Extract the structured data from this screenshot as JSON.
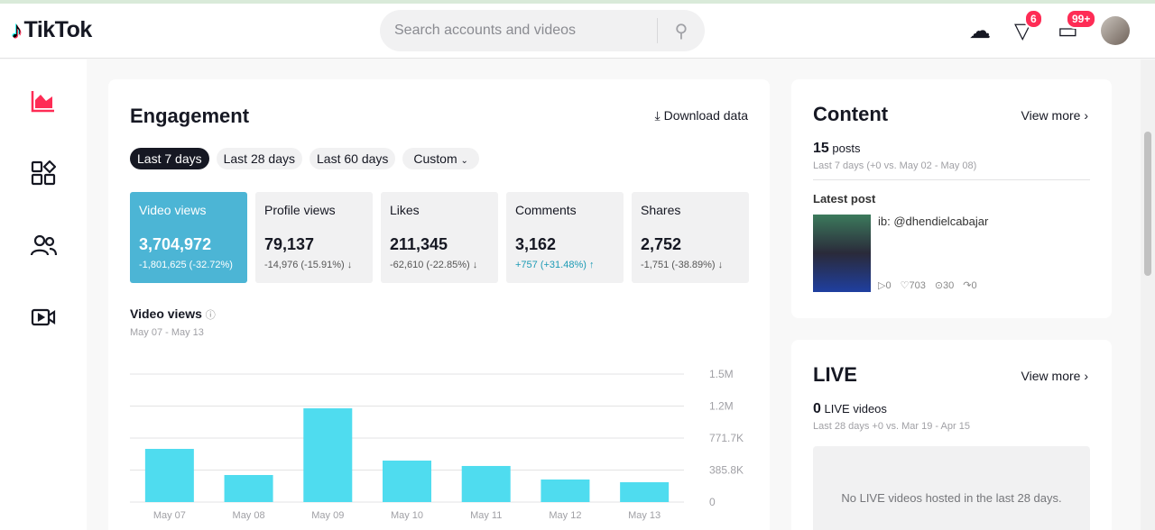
{
  "header": {
    "logo": "TikTok",
    "search_placeholder": "Search accounts and videos",
    "inbox_badge": "6",
    "messages_badge": "99+"
  },
  "engagement": {
    "title": "Engagement",
    "download": "Download data",
    "ranges": [
      "Last 7 days",
      "Last 28 days",
      "Last 60 days",
      "Custom"
    ],
    "metrics": [
      {
        "label": "Video views",
        "value": "3,704,972",
        "delta": "-1,801,625 (-32.72%)",
        "dir": "none"
      },
      {
        "label": "Profile views",
        "value": "79,137",
        "delta": "-14,976 (-15.91%)",
        "dir": "down"
      },
      {
        "label": "Likes",
        "value": "211,345",
        "delta": "-62,610 (-22.85%)",
        "dir": "down"
      },
      {
        "label": "Comments",
        "value": "3,162",
        "delta": "+757 (+31.48%)",
        "dir": "up"
      },
      {
        "label": "Shares",
        "value": "2,752",
        "delta": "-1,751 (-38.89%)",
        "dir": "down"
      }
    ],
    "chart_title": "Video views",
    "chart_range": "May 07 - May 13"
  },
  "chart_data": {
    "type": "bar",
    "title": "Video views",
    "categories": [
      "May 07",
      "May 08",
      "May 09",
      "May 10",
      "May 11",
      "May 12",
      "May 13"
    ],
    "values": [
      641000,
      326000,
      1130000,
      500000,
      435000,
      272000,
      239000
    ],
    "ylim": [
      0,
      1543000
    ],
    "yticks": [
      "0",
      "385.8K",
      "771.7K",
      "1.2M",
      "1.5M"
    ],
    "color": "#4fdcef",
    "grid": true
  },
  "content": {
    "title": "Content",
    "view_more": "View more",
    "count": "15",
    "count_label": "posts",
    "sub": "Last 7 days (+0 vs. May 02 - May 08)",
    "latest": "Latest post",
    "caption": "ib: @dhendielcabajar",
    "plays": "0",
    "likes": "703",
    "comments": "30",
    "shares": "0"
  },
  "live": {
    "title": "LIVE",
    "view_more": "View more",
    "count": "0",
    "count_label": "LIVE videos",
    "sub": "Last 28 days +0 vs. Mar 19 - Apr 15",
    "empty": "No LIVE videos hosted in the last 28 days."
  }
}
